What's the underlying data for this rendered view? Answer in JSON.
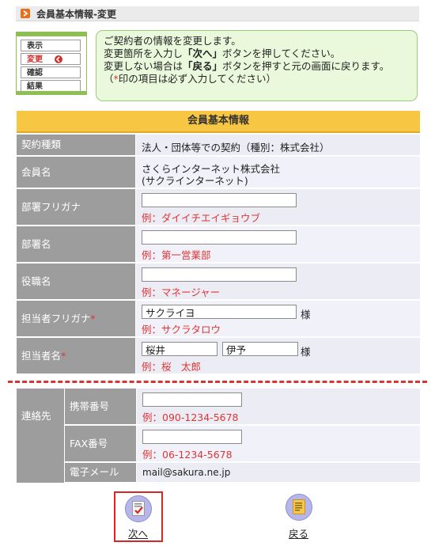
{
  "header": {
    "title": "会員基本情報-変更"
  },
  "steps": [
    {
      "label": "表示",
      "active": false
    },
    {
      "label": "変更",
      "active": true
    },
    {
      "label": "確認",
      "active": false
    },
    {
      "label": "結果",
      "active": false
    }
  ],
  "notice": {
    "line1": "ご契約者の情報を変更します。",
    "line2a": "変更箇所を入力し",
    "line2b": "「次へ」",
    "line2c": "ボタンを押してください。",
    "line3a": "変更しない場合は",
    "line3b": "「戻る」",
    "line3c": "ボタンを押すと元の画面に戻ります。",
    "line4a": "（",
    "line4b": "*",
    "line4c": "印の項目は必ず入力してください）"
  },
  "table": {
    "title": "会員基本情報",
    "contract_type_label": "契約種類",
    "contract_type_value": "法人・団体等での契約（種別：株式会社）",
    "member_name_label": "会員名",
    "member_name_line1": "さくらインターネット株式会社",
    "member_name_line2": "(サクラインターネット)",
    "dept_kana_label": "部署フリガナ",
    "dept_kana_value": "",
    "dept_kana_example": "例：ダイイチエイギョウブ",
    "dept_label": "部署名",
    "dept_value": "",
    "dept_example": "例：第一営業部",
    "position_label": "役職名",
    "position_value": "",
    "position_example": "例：マネージャー",
    "contact_kana_label": "担当者フリガナ",
    "contact_kana_value": "サクライヨ",
    "contact_kana_example": "例：サクラタロウ",
    "contact_name_label": "担当者名",
    "contact_last_name": "桜井",
    "contact_first_name": "伊予",
    "contact_name_example": "例：桜　太郎",
    "honorific": "様",
    "required_mark": "*"
  },
  "contact": {
    "label": "連絡先",
    "mobile_label": "携帯番号",
    "mobile_value": "",
    "mobile_example": "例：090-1234-5678",
    "fax_label": "FAX番号",
    "fax_value": "",
    "fax_example": "例：06-1234-5678",
    "email_label": "電子メール",
    "email_value": "mail@sakura.ne.jp"
  },
  "buttons": {
    "next": "次へ",
    "back": "戻る"
  },
  "colors": {
    "accent_orange": "#e8701a",
    "header_yellow": "#f7c642",
    "notice_green": "#eaf8dc",
    "required_red": "#e03535"
  }
}
